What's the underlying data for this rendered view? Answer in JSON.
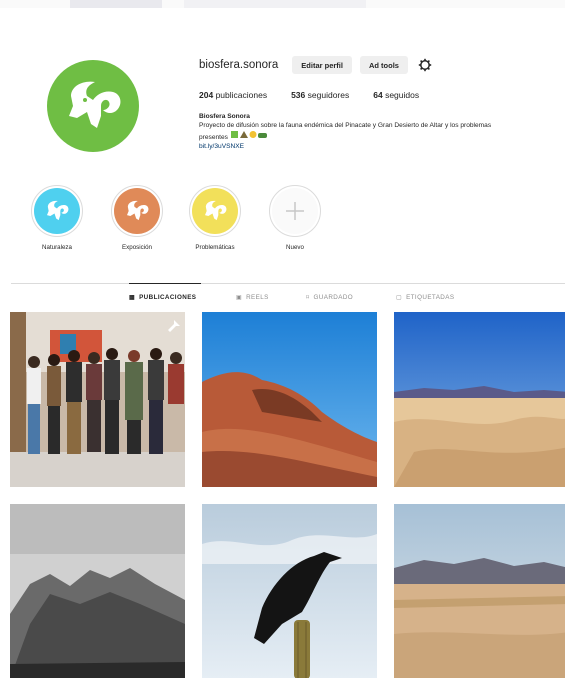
{
  "profile": {
    "username": "biosfera.sonora",
    "edit_label": "Editar perfil",
    "adtools_label": "Ad tools",
    "stats": {
      "posts_count": "204",
      "posts_label": "publicaciones",
      "followers_count": "536",
      "followers_label": "seguidores",
      "following_count": "64",
      "following_label": "seguidos"
    },
    "bio": {
      "name": "Biosfera Sonora",
      "line1": "Proyecto de difusión sobre la fauna endémica del Pinacate y Gran Desierto de Altar y los problemas",
      "line2": "presentes",
      "link": "bit.ly/3uVSNXE"
    }
  },
  "highlights": [
    {
      "label": "Naturaleza",
      "color": "#4fd0ef"
    },
    {
      "label": "Exposición",
      "color": "#e08a58"
    },
    {
      "label": "Problemáticas",
      "color": "#f2e05a"
    },
    {
      "label": "Nuevo",
      "color": "#ffffff"
    }
  ],
  "tabs": [
    {
      "label": "PUBLICACIONES",
      "icon": "grid-icon",
      "active": true
    },
    {
      "label": "REELS",
      "icon": "reels-icon",
      "active": false
    },
    {
      "label": "GUARDADO",
      "icon": "bookmark-icon",
      "active": false
    },
    {
      "label": "ETIQUETADAS",
      "icon": "tag-icon",
      "active": false
    }
  ],
  "posts": [
    {
      "subject": "group-photo",
      "pinned": true
    },
    {
      "subject": "red-hill"
    },
    {
      "subject": "sand-dunes"
    },
    {
      "subject": "mountain-bw"
    },
    {
      "subject": "raven-on-cactus"
    },
    {
      "subject": "desert-mountains"
    }
  ],
  "colors": {
    "brand_green": "#6fbe44",
    "link_blue": "#00376b",
    "muted_text": "#8e8e8e",
    "button_bg": "#efefef"
  }
}
